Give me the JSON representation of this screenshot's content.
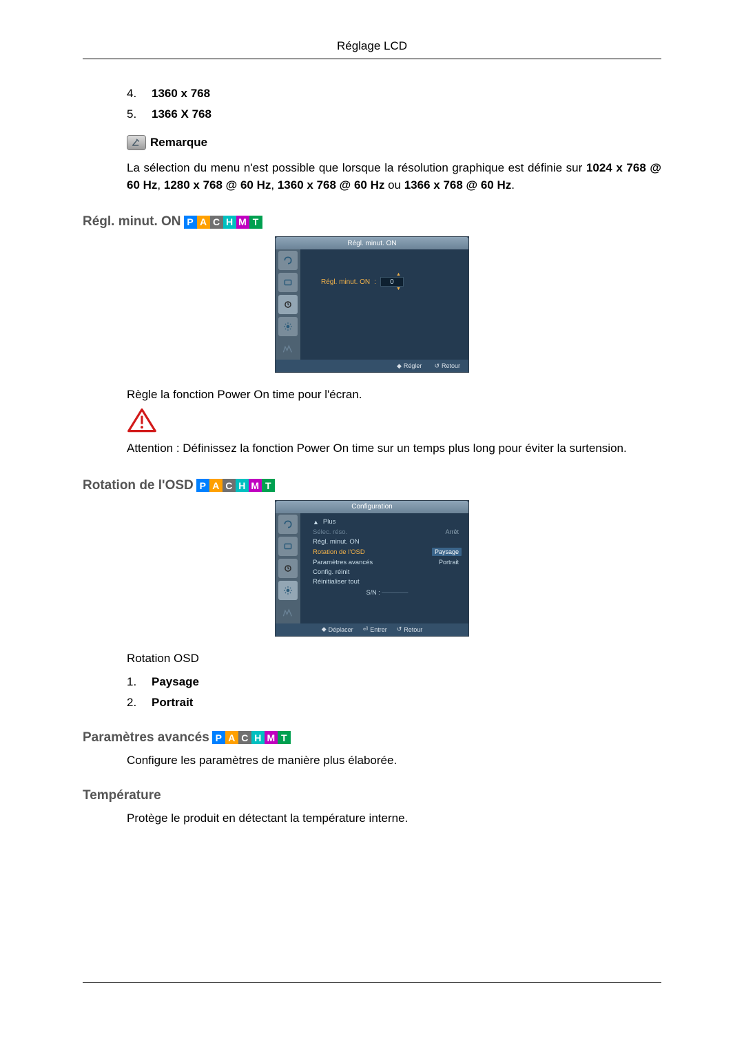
{
  "header": {
    "title": "Réglage LCD"
  },
  "list1": [
    {
      "num": "4.",
      "text": "1360 x 768"
    },
    {
      "num": "5.",
      "text": "1366 X 768"
    }
  ],
  "noteLabel": "Remarque",
  "noteBody": "La sélection du menu n'est possible que lorsque la résolution graphique est définie sur ",
  "noteBold": "1024 x 768 @ 60 Hz",
  "noteSep1": ", ",
  "noteBold2": "1280 x 768 @ 60 Hz",
  "noteSep2": ", ",
  "noteBold3": "1360 x 768 @ 60 Hz",
  "noteOr": " ou ",
  "noteBold4": "1366 x 768 @ 60 Hz",
  "noteEnd": ".",
  "sec1": {
    "title": "Régl. minut. ON",
    "osdTitle": "Régl. minut. ON",
    "fieldLabel": "Régl. minut. ON",
    "fieldSep": ":",
    "fieldValue": "0",
    "foot1": "Régler",
    "foot2": "Retour",
    "desc": "Règle la fonction Power On time pour l'écran.",
    "warn": "Attention : Définissez la fonction Power On time sur un temps plus long pour éviter la surtension."
  },
  "sec2": {
    "title": "Rotation de l'OSD",
    "osdTitle": "Configuration",
    "rows": {
      "plus": "Plus",
      "selec": "Sélec. réso.",
      "selec_val": "Arrêt",
      "minut": "Régl. minut. ON",
      "rot": "Rotation de l'OSD",
      "rot_val": "Paysage",
      "param": "Paramètres avancés",
      "param_val": "Portrait",
      "reinit": "Config. réinit",
      "reinit_all": "Réinitialiser tout"
    },
    "sn": "S/N :",
    "foot1": "Déplacer",
    "foot2": "Entrer",
    "foot3": "Retour",
    "caption": "Rotation OSD",
    "items": [
      {
        "num": "1.",
        "text": "Paysage"
      },
      {
        "num": "2.",
        "text": "Portrait"
      }
    ]
  },
  "sec3": {
    "title": "Paramètres avancés",
    "desc": "Configure les paramètres de manière plus élaborée."
  },
  "sec4": {
    "title": "Température",
    "desc": "Protège le produit en détectant la température interne."
  },
  "badges": [
    "P",
    "A",
    "C",
    "H",
    "M",
    "T"
  ]
}
